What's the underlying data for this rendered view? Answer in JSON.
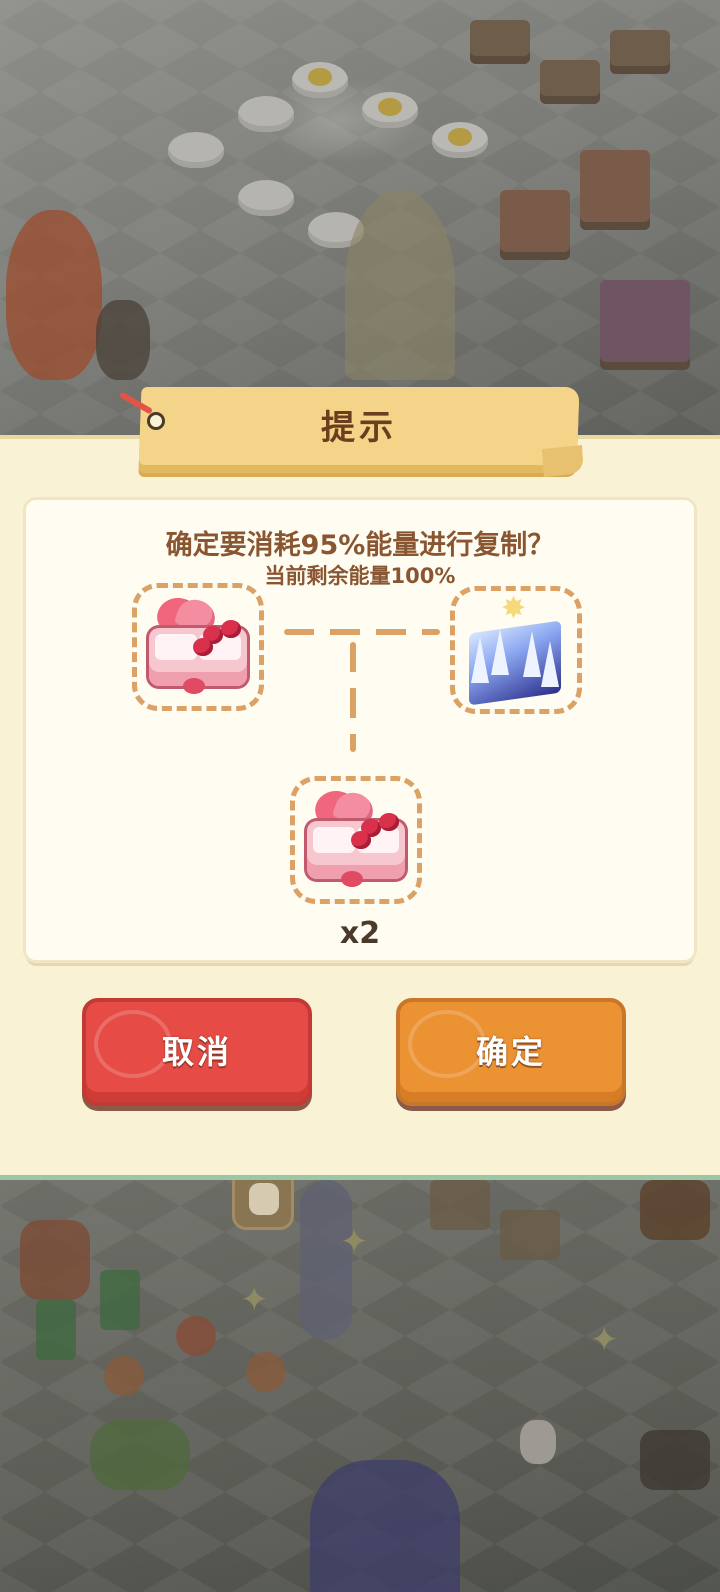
{
  "dialog": {
    "title": "提示",
    "question": "确定要消耗95%能量进行复制？",
    "energy_info": "当前剩余能量100%",
    "result_count": "x2",
    "cancel_label": "取消",
    "confirm_label": "确定"
  },
  "items": {
    "source": "bento-box-icon",
    "target": "crystal-castle-icon",
    "result": "bento-box-icon"
  },
  "colors": {
    "panel_bg": "#f9f2d4",
    "title_text": "#6b3e1f",
    "body_text": "#8a5632",
    "slot_border": "#dba165",
    "cancel_button": "#e64c45",
    "confirm_button": "#eb9233"
  }
}
